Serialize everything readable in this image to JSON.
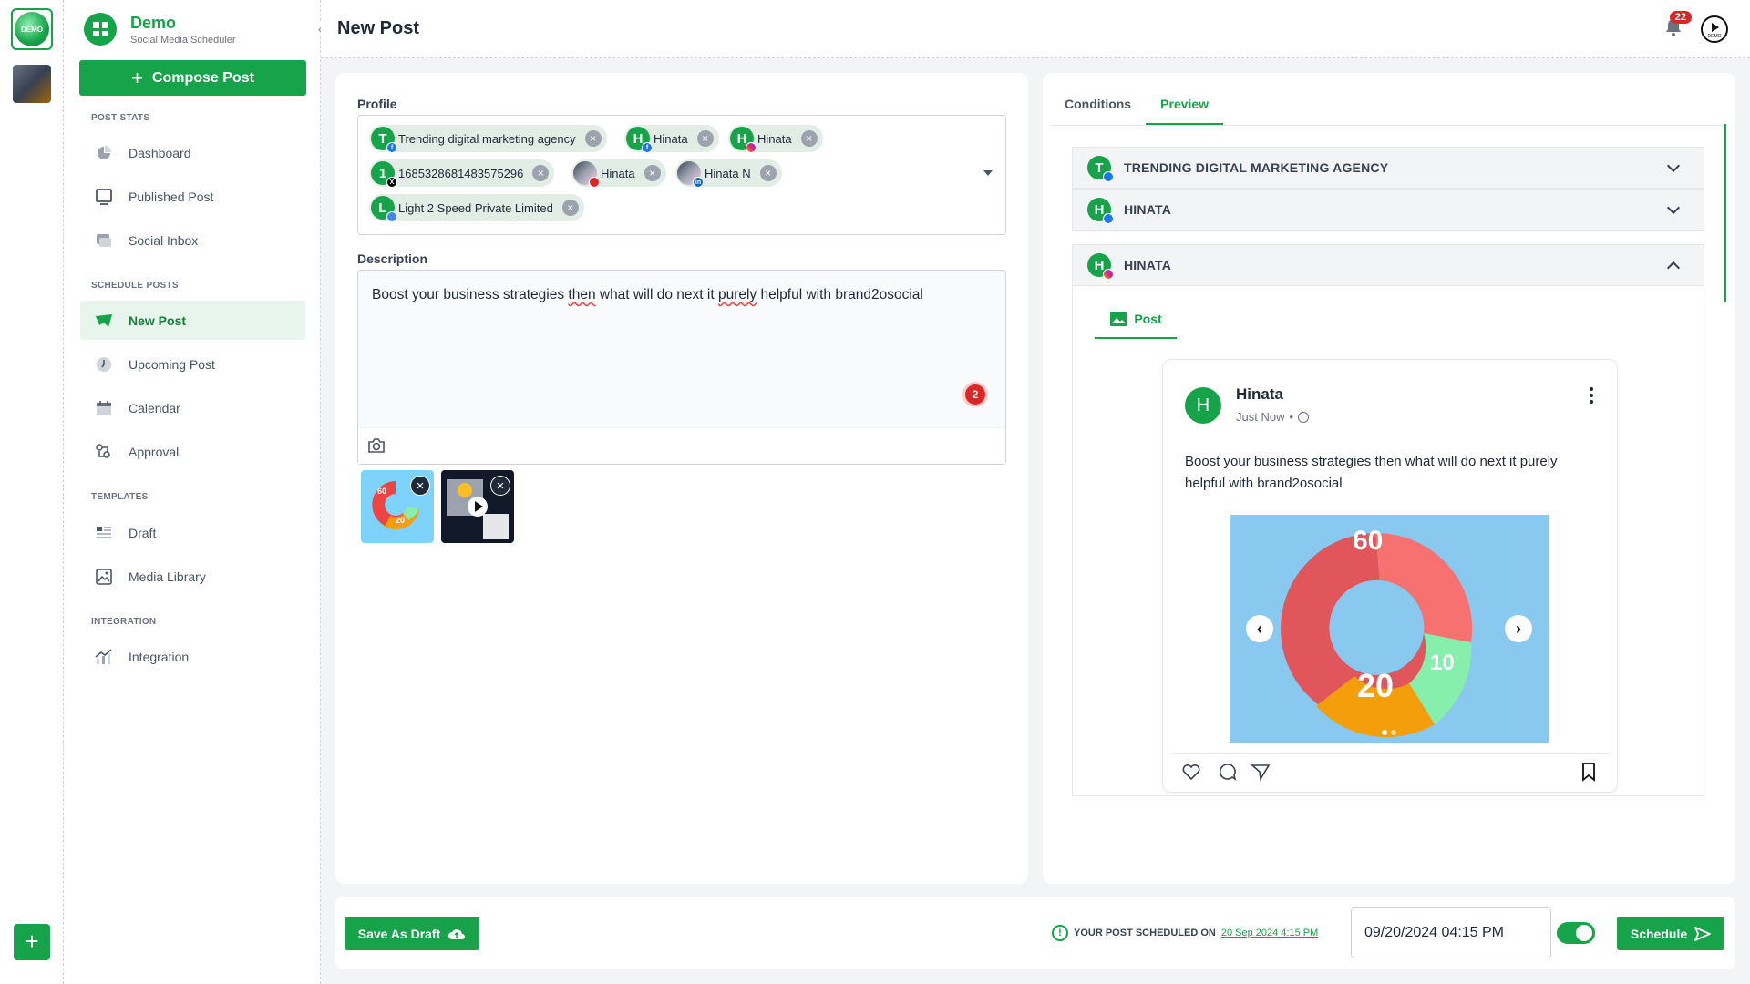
{
  "rail": {
    "workspace_label": "DEMO",
    "add_label": "+"
  },
  "sidebar": {
    "brand_name": "Demo",
    "brand_sub": "Social Media Scheduler",
    "compose_label": "Compose Post",
    "sections": {
      "post_stats": "POST STATS",
      "schedule_posts": "SCHEDULE POSTS",
      "templates": "TEMPLATES",
      "integration": "INTEGRATION"
    },
    "items": [
      {
        "label": "Dashboard",
        "icon": "dashboard-icon"
      },
      {
        "label": "Published Post",
        "icon": "published-icon"
      },
      {
        "label": "Social Inbox",
        "icon": "inbox-icon"
      },
      {
        "label": "New Post",
        "icon": "new-post-icon",
        "active": true
      },
      {
        "label": "Upcoming Post",
        "icon": "clock-icon"
      },
      {
        "label": "Calendar",
        "icon": "calendar-icon"
      },
      {
        "label": "Approval",
        "icon": "approval-icon"
      },
      {
        "label": "Draft",
        "icon": "draft-icon"
      },
      {
        "label": "Media Library",
        "icon": "media-icon"
      },
      {
        "label": "Integration",
        "icon": "integration-icon"
      }
    ]
  },
  "header": {
    "title": "New Post",
    "notification_count": "22",
    "demo_label": "DEMO"
  },
  "composer": {
    "profile_label": "Profile",
    "profiles": [
      {
        "initial": "T",
        "name": "Trending digital marketing agency",
        "network": "facebook"
      },
      {
        "initial": "H",
        "name": "Hinata",
        "network": "facebook"
      },
      {
        "initial": "H",
        "name": "Hinata",
        "network": "instagram"
      },
      {
        "initial": "1",
        "name": "1685328681483575296",
        "network": "x"
      },
      {
        "initial": "",
        "name": "Hinata",
        "network": "youtube"
      },
      {
        "initial": "",
        "name": "Hinata N",
        "network": "linkedin"
      },
      {
        "initial": "L",
        "name": "Light 2 Speed Private Limited",
        "network": "google-business"
      }
    ],
    "description_label": "Description",
    "description_parts": [
      "Boost your business strategies ",
      "then",
      " what will do next it ",
      "purely",
      " helpful with brand2osocial"
    ],
    "grammar_count": "2",
    "media": [
      {
        "type": "image",
        "label": "60 20 10 donut chart image"
      },
      {
        "type": "video",
        "label": "video thumbnail"
      }
    ]
  },
  "preview": {
    "tabs": [
      "Conditions",
      "Preview"
    ],
    "active_tab": "Preview",
    "accordions": [
      {
        "initial": "T",
        "title": "TRENDING DIGITAL MARKETING AGENCY",
        "network": "facebook",
        "expanded": false
      },
      {
        "initial": "H",
        "title": "HINATA",
        "network": "facebook",
        "expanded": false
      },
      {
        "initial": "H",
        "title": "HINATA",
        "network": "instagram",
        "expanded": true
      }
    ],
    "subtab": "Post",
    "post": {
      "avatar_initial": "H",
      "name": "Hinata",
      "time": "Just Now",
      "separator": "•",
      "text": "Boost your business strategies then what will do next it purely helpful with brand2osocial",
      "image_numbers": [
        "60",
        "20",
        "10"
      ]
    }
  },
  "footer": {
    "save_draft_label": "Save As Draft",
    "schedule_info": "YOUR POST SCHEDULED ON",
    "schedule_link": "20 Sep 2024 4:15 PM",
    "date_value": "09/20/2024 04:15 PM",
    "toggle_on": true,
    "schedule_label": "Schedule"
  },
  "colors": {
    "accent": "#16a34a",
    "accent_light": "#e8f5ec",
    "badge_red": "#dc2626"
  }
}
